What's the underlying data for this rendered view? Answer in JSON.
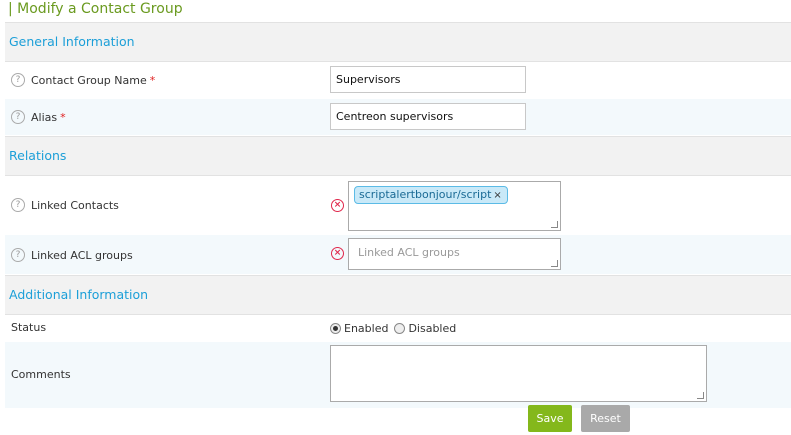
{
  "page_title": "| Modify a Contact Group",
  "sections": {
    "general": "General Information",
    "relations": "Relations",
    "additional": "Additional Information"
  },
  "fields": {
    "name": {
      "label": "Contact Group Name",
      "required": "*",
      "value": "Supervisors"
    },
    "alias": {
      "label": "Alias",
      "required": "*",
      "value": "Centreon supervisors"
    },
    "linked_contacts": {
      "label": "Linked Contacts",
      "tags": [
        "scriptalertbonjour/script"
      ],
      "remove_symbol": "×"
    },
    "linked_acl": {
      "label": "Linked ACL groups",
      "placeholder": "Linked ACL groups"
    },
    "status": {
      "label": "Status",
      "options": [
        "Enabled",
        "Disabled"
      ],
      "selected": "Enabled"
    },
    "comments": {
      "label": "Comments",
      "value": ""
    }
  },
  "buttons": {
    "save": "Save",
    "reset": "Reset"
  },
  "icons": {
    "help": "help-icon",
    "clear": "clear-icon"
  },
  "colors": {
    "title": "#6a9a1f",
    "section": "#1c9fd8",
    "save": "#84b81b",
    "reset": "#a9a9a9",
    "required": "#e02020",
    "clear": "#e0284c"
  }
}
